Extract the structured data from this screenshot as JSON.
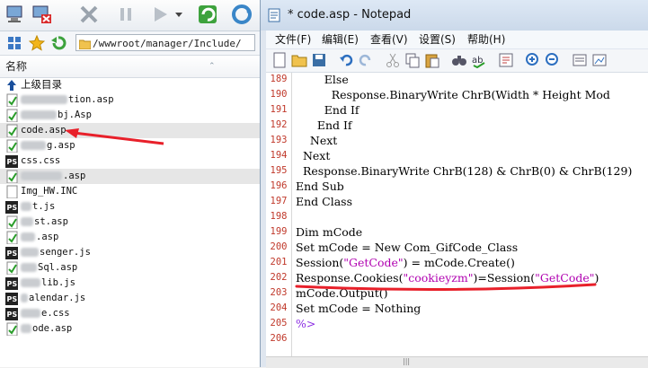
{
  "explorer": {
    "path": "/wwwroot/manager/Include/",
    "column_name": "名称",
    "parent_dir": "上级目录",
    "files": [
      {
        "name": "tion.asp",
        "icon": "asp-file-icon",
        "blur": 52
      },
      {
        "name": "bj.Asp",
        "icon": "asp-file-icon",
        "blur": 40
      },
      {
        "name": "code.asp",
        "icon": "asp-file-icon",
        "blur": 0,
        "selected": true
      },
      {
        "name": "g.asp",
        "icon": "asp-file-icon",
        "blur": 28
      },
      {
        "name": "css.css",
        "icon": "ps-file-icon",
        "blur": 0
      },
      {
        "name": ".asp",
        "icon": "asp-file-icon",
        "blur": 46,
        "highlight": true
      },
      {
        "name": "Img_HW.INC",
        "icon": "file-icon",
        "blur": 0
      },
      {
        "name": "t.js",
        "icon": "ps-file-icon",
        "blur": 12
      },
      {
        "name": "st.asp",
        "icon": "asp-file-icon",
        "blur": 14
      },
      {
        "name": ".asp",
        "icon": "asp-file-icon",
        "blur": 16
      },
      {
        "name": "senger.js",
        "icon": "ps-file-icon",
        "blur": 20
      },
      {
        "name": "Sql.asp",
        "icon": "asp-file-icon",
        "blur": 18
      },
      {
        "name": "lib.js",
        "icon": "ps-file-icon",
        "blur": 22
      },
      {
        "name": "alendar.js",
        "icon": "ps-file-icon",
        "blur": 8
      },
      {
        "name": "e.css",
        "icon": "ps-file-icon",
        "blur": 22
      },
      {
        "name": "ode.asp",
        "icon": "asp-file-icon",
        "blur": 12
      }
    ]
  },
  "notepad": {
    "title": "* code.asp - Notepad",
    "menu": [
      "文件(F)",
      "编辑(E)",
      "查看(V)",
      "设置(S)",
      "帮助(H)"
    ],
    "lines": [
      {
        "n": "189",
        "text": "        Else"
      },
      {
        "n": "190",
        "text": "          Response.BinaryWrite ChrB(Width * Height Mod"
      },
      {
        "n": "191",
        "text": "        End If"
      },
      {
        "n": "192",
        "text": "      End If"
      },
      {
        "n": "193",
        "text": "    Next"
      },
      {
        "n": "194",
        "text": "  Next"
      },
      {
        "n": "195",
        "text": "  Response.BinaryWrite ChrB(128) & ChrB(0) & ChrB(129)"
      },
      {
        "n": "196",
        "text": "End Sub"
      },
      {
        "n": "197",
        "text": "End Class"
      },
      {
        "n": "198",
        "text": ""
      },
      {
        "n": "199",
        "text": "Dim mCode"
      },
      {
        "n": "200",
        "text": "Set mCode = New Com_GifCode_Class"
      },
      {
        "n": "201",
        "text": "Session(\"GetCode\") = mCode.Create()"
      },
      {
        "n": "202",
        "text": "Response.Cookies(\"cookieyzm\")=Session(\"GetCode\")"
      },
      {
        "n": "203",
        "text": "mCode.Output()"
      },
      {
        "n": "204",
        "text": "Set mCode = Nothing"
      },
      {
        "n": "205",
        "text": "%>"
      },
      {
        "n": "206",
        "text": ""
      }
    ]
  },
  "colors": {
    "line_number": "#c0392b",
    "annotation": "#e8202a",
    "string": "#b000b0"
  }
}
